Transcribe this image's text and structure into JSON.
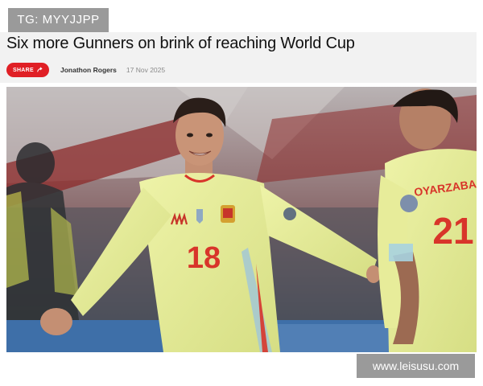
{
  "tg_badge": "TG: MYYJJPP",
  "article": {
    "headline": "Six more Gunners on brink of reaching World Cup",
    "share_label": "SHARE",
    "author": "Jonathon Rogers",
    "date": "17 Nov 2025"
  },
  "photo": {
    "player_number_front": "18",
    "player_name_back": "OYARZABAL",
    "player_number_back": "21"
  },
  "watermark": "www.leisusu.com",
  "colors": {
    "share_red": "#e01f25",
    "kit_yellow": "#e4ec8e",
    "kit_number_red": "#d8352a",
    "stand_red": "#8c2a2a"
  }
}
